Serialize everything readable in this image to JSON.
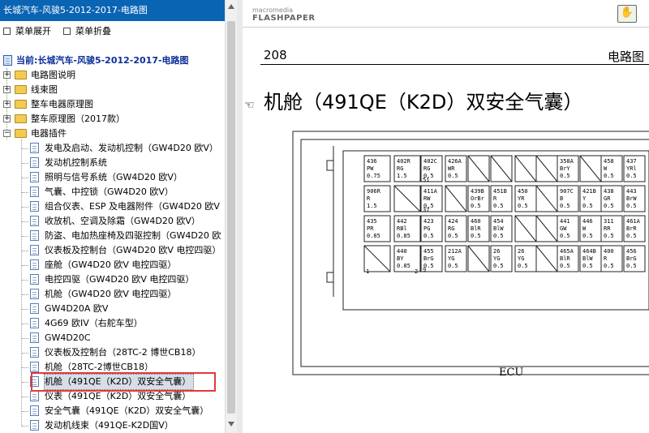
{
  "window": {
    "title": "长城汽车-风骏5-2012-2017-电路图"
  },
  "toolbar": {
    "expand_label": "菜单展开",
    "collapse_label": "菜单折叠"
  },
  "tree": {
    "root_label": "当前:长城汽车-风骏5-2012-2017-电路图",
    "folders": [
      "电路图说明",
      "线束图",
      "整车电器原理图",
      "整车原理图（2017款）",
      "电器插件"
    ],
    "items": [
      "发电及启动、发动机控制（GW4D20 欧V）",
      "发动机控制系统",
      "照明与信号系统（GW4D20 欧V）",
      "气囊、中控锁（GW4D20 欧V）",
      "组合仪表、ESP 及电器附件（GW4D20 欧V",
      "收放机、空调及除霜（GW4D20 欧V）",
      "防盗、电加热座椅及四驱控制（GW4D20 欧",
      "仪表板及控制台（GW4D20 欧V 电控四驱）",
      "座舱（GW4D20 欧V 电控四驱）",
      "电控四驱（GW4D20 欧V 电控四驱）",
      "机舱（GW4D20 欧V 电控四驱）",
      "GW4D20A 欧V",
      "4G69 欧IV（右舵车型）",
      "GW4D20C",
      "仪表板及控制台（28TC-2 博世CB18）",
      "机舱（28TC-2博世CB18）",
      "机舱（491QE（K2D）双安全气囊）",
      "仪表（491QE（K2D）双安全气囊）",
      "安全气囊（491QE（K2D）双安全气囊）",
      "发动机线束（491QE-K2D国V）"
    ],
    "selected_index": 16
  },
  "viewer": {
    "logo_small": "macromedia",
    "logo_big": "FLASHPAPER",
    "page_number": "208",
    "section_title": "电路图",
    "heading": "机舱（491QE（K2D）双安全气囊）",
    "connector_label": "ECU"
  },
  "connector": {
    "rows": [
      [
        {
          "code": "436",
          "color": "PW",
          "size": "0.75"
        },
        {
          "code": "402R",
          "color": "RG",
          "size": "1.5"
        },
        {
          "code": "402C",
          "color": "RG",
          "size": "0.5"
        },
        {
          "code": "426A",
          "color": "WR",
          "size": "0.5"
        },
        {
          "blank": true
        },
        {
          "blank": true
        },
        {
          "blank": true
        },
        {
          "blank": true
        },
        {
          "code": "358A",
          "color": "BrY",
          "size": "0.5"
        },
        {
          "blank": true
        },
        {
          "code": "458",
          "color": "W",
          "size": "0.5"
        },
        {
          "code": "437",
          "color": "YRl",
          "size": "0.5"
        }
      ],
      [
        {
          "code": "906R",
          "color": "R",
          "size": "1.5"
        },
        {
          "blank": true
        },
        {
          "code": "411A",
          "color": "RW",
          "size": "0.5"
        },
        {
          "blank": true
        },
        {
          "code": "439B",
          "color": "OrBr",
          "size": "0.5"
        },
        {
          "code": "451B",
          "color": "R",
          "size": "0.5"
        },
        {
          "code": "450",
          "color": "YR",
          "size": "0.5"
        },
        {
          "blank": true
        },
        {
          "code": "907C",
          "color": "B",
          "size": "0.5"
        },
        {
          "code": "421B",
          "color": "Y",
          "size": "0.5"
        },
        {
          "code": "438",
          "color": "GR",
          "size": "0.5"
        },
        {
          "code": "443",
          "color": "BrW",
          "size": "0.5"
        }
      ],
      [
        {
          "code": "435",
          "color": "PR",
          "size": "0.85"
        },
        {
          "code": "442",
          "color": "RBl",
          "size": "0.85"
        },
        {
          "code": "423",
          "color": "PG",
          "size": "0.5"
        },
        {
          "code": "424",
          "color": "RG",
          "size": "0.5"
        },
        {
          "code": "460",
          "color": "BlR",
          "size": "0.5"
        },
        {
          "code": "454",
          "color": "BlW",
          "size": "0.5"
        },
        {
          "blank": true
        },
        {
          "blank": true
        },
        {
          "code": "441",
          "color": "GW",
          "size": "0.5"
        },
        {
          "code": "446",
          "color": "W",
          "size": "0.5"
        },
        {
          "code": "311",
          "color": "RR",
          "size": "0.5"
        },
        {
          "code": "461A",
          "color": "BrR",
          "size": "0.5"
        }
      ],
      [
        {
          "blank": true
        },
        {
          "code": "440",
          "color": "BY",
          "size": "0.85"
        },
        {
          "code": "455",
          "color": "BrG",
          "size": "0.5"
        },
        {
          "code": "212A",
          "color": "YG",
          "size": "0.5"
        },
        {
          "blank": true
        },
        {
          "code": "26",
          "color": "YG",
          "size": "0.5"
        },
        {
          "code": "26",
          "color": "YG",
          "size": "0.5"
        },
        {
          "blank": true
        },
        {
          "code": "465A",
          "color": "BlR",
          "size": "0.5"
        },
        {
          "code": "464B",
          "color": "BlW",
          "size": "0.5"
        },
        {
          "code": "400",
          "color": "R",
          "size": "0.5"
        },
        {
          "code": "456",
          "color": "BrG",
          "size": "0.5"
        }
      ]
    ],
    "pin_numbers": [
      "51",
      "37",
      "1",
      "2",
      "9"
    ]
  }
}
